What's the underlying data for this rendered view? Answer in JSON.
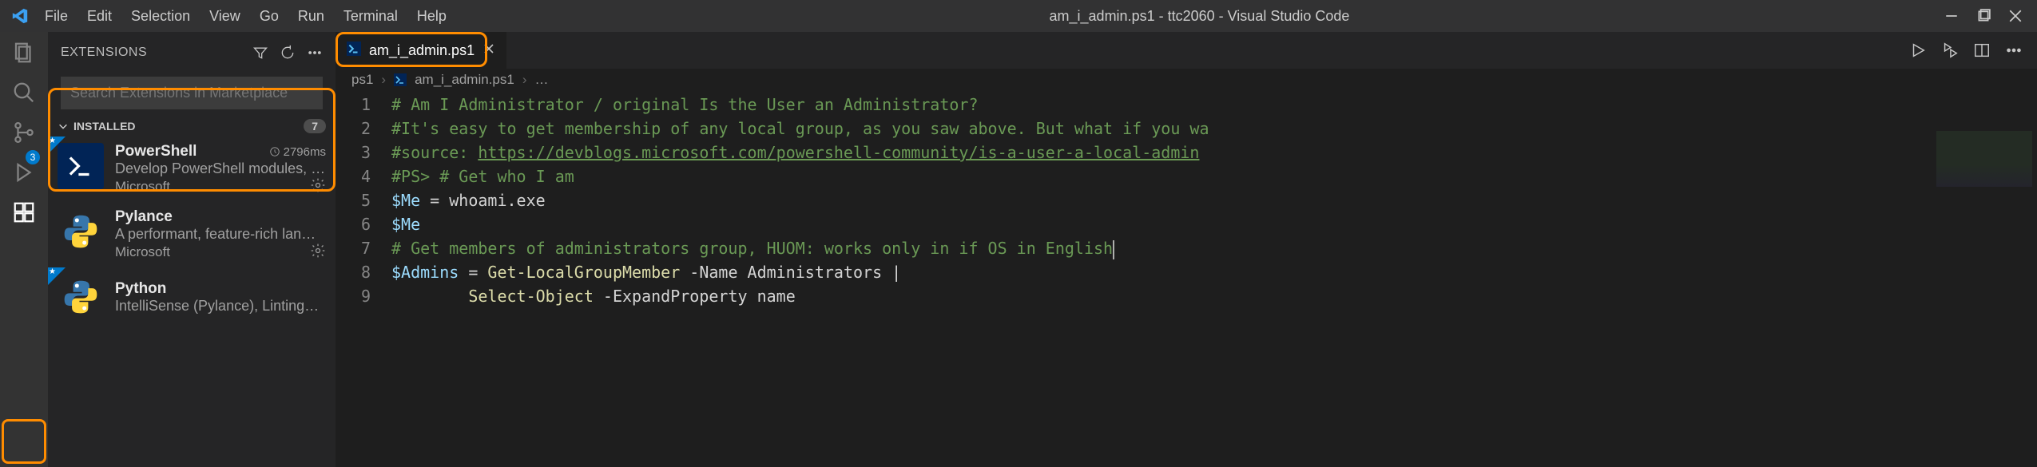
{
  "window": {
    "title": "am_i_admin.ps1 - ttc2060 - Visual Studio Code"
  },
  "menu": [
    "File",
    "Edit",
    "Selection",
    "View",
    "Go",
    "Run",
    "Terminal",
    "Help"
  ],
  "activitybar": {
    "source_control_badge": "3"
  },
  "sidebar": {
    "title": "EXTENSIONS",
    "search_placeholder": "Search Extensions in Marketplace",
    "section": {
      "label": "INSTALLED",
      "count": "7"
    },
    "items": [
      {
        "name": "PowerShell",
        "desc": "Develop PowerShell modules, …",
        "publisher": "Microsoft",
        "time": "2796ms"
      },
      {
        "name": "Pylance",
        "desc": "A performant, feature-rich lan…",
        "publisher": "Microsoft",
        "time": ""
      },
      {
        "name": "Python",
        "desc": "IntelliSense (Pylance), Linting…",
        "publisher": "",
        "time": ""
      }
    ]
  },
  "tabs": {
    "active": {
      "label": "am_i_admin.ps1"
    }
  },
  "breadcrumb": {
    "parts": [
      "ps1",
      "am_i_admin.ps1",
      "…"
    ]
  },
  "code": {
    "lines": [
      {
        "n": "1",
        "t": "comment",
        "text": "# Am I Administrator / original Is the User an Administrator?"
      },
      {
        "n": "2",
        "t": "comment",
        "text": "#It's easy to get membership of any local group, as you saw above. But what if you wa"
      },
      {
        "n": "3",
        "t": "comment_link",
        "prefix": "#source: ",
        "link": "https://devblogs.microsoft.com/powershell-community/is-a-user-a-local-admin"
      },
      {
        "n": "4",
        "t": "comment",
        "text": "#PS> # Get who I am"
      },
      {
        "n": "5",
        "t": "assign",
        "var": "$Me",
        "op": " = ",
        "rhs": "whoami.exe"
      },
      {
        "n": "6",
        "t": "var",
        "text": "$Me"
      },
      {
        "n": "7",
        "t": "comment",
        "text": "# Get members of administrators group, HUOM: works only in if OS in English",
        "cursor": true
      },
      {
        "n": "8",
        "t": "pipe",
        "var": "$Admins",
        "op": " = ",
        "cmd": "Get-LocalGroupMember",
        "param": " -Name ",
        "arg": "Administrators",
        "pipe": " |"
      },
      {
        "n": "9",
        "t": "cont",
        "indent": "        ",
        "cmd": "Select-Object",
        "param": " -ExpandProperty ",
        "arg": "name"
      }
    ]
  }
}
